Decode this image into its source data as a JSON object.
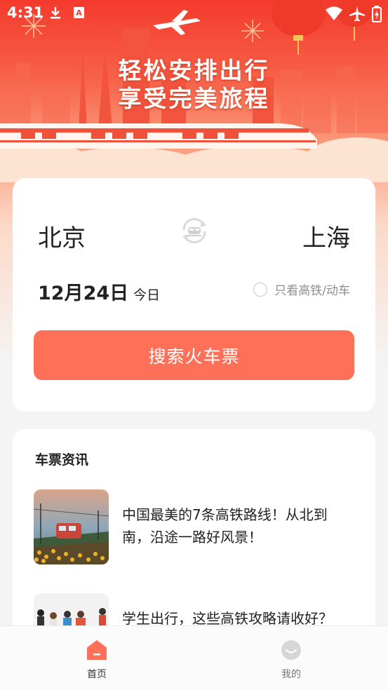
{
  "status_bar": {
    "time": "4:31",
    "icons": [
      "download-icon",
      "font-a-icon",
      "wifi-icon",
      "airplane-mode-icon",
      "battery-icon"
    ]
  },
  "hero": {
    "title_line1": "轻松安排出行",
    "title_line2": "享受完美旅程"
  },
  "search": {
    "from_city": "北京",
    "to_city": "上海",
    "date": "12月24日",
    "weekday": "今日",
    "high_speed_only_label": "只看高铁/动车",
    "search_button_label": "搜索火车票"
  },
  "news": {
    "section_title": "车票资讯",
    "items": [
      {
        "text": "中国最美的7条高铁路线！从北到南，沿途一路好风景！"
      },
      {
        "text": "学生出行，这些高铁攻略请收好？"
      }
    ]
  },
  "bottom_nav": {
    "items": [
      {
        "label": "首页",
        "icon": "home-icon",
        "active": true
      },
      {
        "label": "我的",
        "icon": "profile-icon",
        "active": false
      }
    ]
  },
  "colors": {
    "accent": "#fe7158",
    "hero_red": "#f43a2c",
    "text_primary": "#222222",
    "text_secondary": "#8f8f8f"
  }
}
